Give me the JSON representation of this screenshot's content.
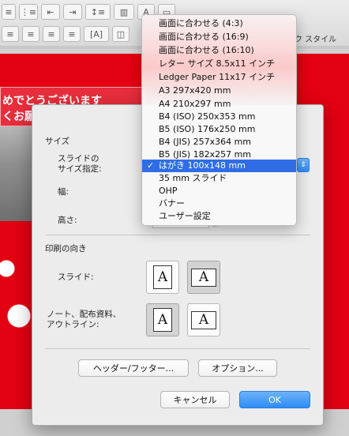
{
  "toolbar": {
    "style_label": "ク スタイル"
  },
  "slide": {
    "banner_line1": "めでとうございます",
    "banner_line2": "くお願"
  },
  "dialog": {
    "size_section": "サイズ",
    "slide_size_label_line1": "スライドの",
    "slide_size_label_line2": "サイズ指定:",
    "width_label": "幅:",
    "height_label": "高さ:",
    "orientation_section": "印刷の向き",
    "slide_orient_label": "スライド:",
    "notes_label_line1": "ノート、配布資料、",
    "notes_label_line2": "アウトライン:",
    "page_glyph": "A",
    "header_footer_button": "ヘッダー/フッター...",
    "options_button": "オプション...",
    "cancel_button": "キャンセル",
    "ok_button": "OK",
    "slide_orientation_selected": "landscape",
    "notes_orientation_selected": "portrait"
  },
  "menu": {
    "check_mark": "✓",
    "selected_index": 9,
    "items": [
      "画面に合わせる (4:3)",
      "画面に合わせる (16:9)",
      "画面に合わせる (16:10)",
      "レター サイズ 8.5x11 インチ",
      "Ledger Paper 11x17 インチ",
      "A3 297x420 mm",
      "A4 210x297 mm",
      "B4 (ISO) 250x353 mm",
      "B5 (ISO) 176x250 mm",
      "B4 (JIS) 257x364 mm",
      "B5 (JIS) 182x257 mm",
      "はがき 100x148 mm",
      "35 mm スライド",
      "OHP",
      "バナー",
      "ユーザー設定"
    ]
  },
  "colors": {
    "slide_red": "#e30012",
    "accent_blue": "#2f6de6"
  }
}
